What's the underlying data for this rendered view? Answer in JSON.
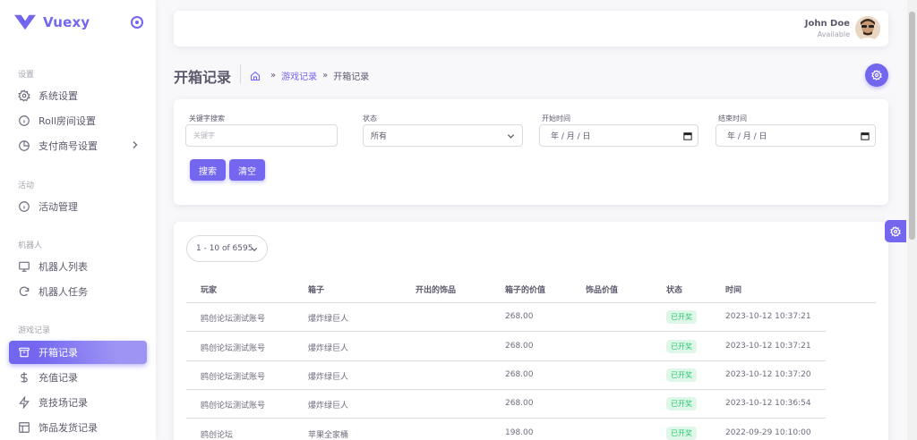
{
  "brand": {
    "name": "Vuexy",
    "color": "#7367f0"
  },
  "sidebar": {
    "sections": [
      {
        "title": "设置",
        "items": [
          {
            "label": "系统设置",
            "icon": "gear-icon"
          },
          {
            "label": "Roll房间设置",
            "icon": "info-circle-icon"
          },
          {
            "label": "支付商号设置",
            "icon": "pie-chart-icon",
            "has_submenu": true
          }
        ]
      },
      {
        "title": "活动",
        "items": [
          {
            "label": "活动管理",
            "icon": "info-circle-icon"
          }
        ]
      },
      {
        "title": "机器人",
        "items": [
          {
            "label": "机器人列表",
            "icon": "screen-share-icon"
          },
          {
            "label": "机器人任务",
            "icon": "refresh-icon"
          }
        ]
      },
      {
        "title": "游戏记录",
        "items": [
          {
            "label": "开箱记录",
            "icon": "archive-icon",
            "active": true
          },
          {
            "label": "充值记录",
            "icon": "dollar-icon"
          },
          {
            "label": "竞技场记录",
            "icon": "lightning-icon"
          },
          {
            "label": "饰品发货记录",
            "icon": "layout-icon"
          }
        ]
      }
    ]
  },
  "user": {
    "name": "John Doe",
    "status": "Available"
  },
  "page": {
    "title": "开箱记录",
    "breadcrumb": {
      "parent": "游戏记录",
      "current": "开箱记录",
      "separator": "»"
    }
  },
  "filters": {
    "keyword": {
      "label": "关键字搜索",
      "placeholder": "关键字"
    },
    "status": {
      "label": "状态",
      "value": "所有"
    },
    "start": {
      "label": "开始时间",
      "value": "年 / 月 / 日"
    },
    "end": {
      "label": "结束时间",
      "value": "年 / 月 / 日"
    },
    "search_button": "搜索",
    "clear_button": "清空"
  },
  "table": {
    "page_size_label": "1 - 10 of 6595",
    "columns": [
      "玩家",
      "箱子",
      "开出的饰品",
      "箱子的价值",
      "饰品价值",
      "状态",
      "时间"
    ],
    "rows": [
      {
        "player": "鸥创论坛测试账号",
        "box": "爆炸绿巨人",
        "item": "",
        "box_value": "268.00",
        "item_value": "",
        "status": "已开奖",
        "time": "2023-10-12 10:37:21"
      },
      {
        "player": "鸥创论坛测试账号",
        "box": "爆炸绿巨人",
        "item": "",
        "box_value": "268.00",
        "item_value": "",
        "status": "已开奖",
        "time": "2023-10-12 10:37:21"
      },
      {
        "player": "鸥创论坛测试账号",
        "box": "爆炸绿巨人",
        "item": "",
        "box_value": "268.00",
        "item_value": "",
        "status": "已开奖",
        "time": "2023-10-12 10:37:20"
      },
      {
        "player": "鸥创论坛测试账号",
        "box": "爆炸绿巨人",
        "item": "",
        "box_value": "268.00",
        "item_value": "",
        "status": "已开奖",
        "time": "2023-10-12 10:36:54"
      },
      {
        "player": "鸥创论坛",
        "box": "苹果全家桶",
        "item": "",
        "box_value": "198.00",
        "item_value": "",
        "status": "已开奖",
        "time": "2022-09-29 10:10:00"
      }
    ]
  },
  "colors": {
    "primary": "#7367f0",
    "success": "#28c76f",
    "success_bg": "#dff7e9"
  }
}
